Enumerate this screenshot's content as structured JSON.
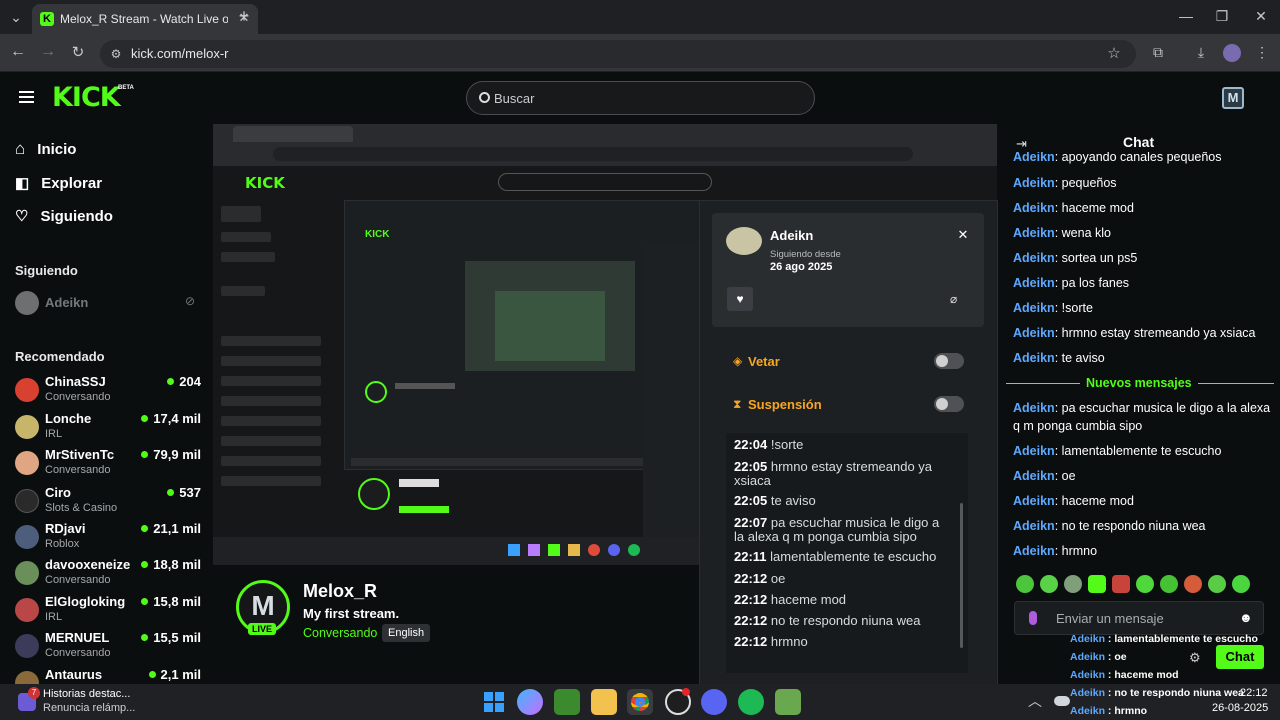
{
  "browser": {
    "tab_title": "Melox_R Stream - Watch Live o",
    "url": "kick.com/melox-r"
  },
  "header": {
    "logo": "KICK",
    "beta": "BETA",
    "search_placeholder": "Buscar"
  },
  "sidebar": {
    "nav": [
      {
        "label": "Inicio",
        "icon": "home-icon"
      },
      {
        "label": "Explorar",
        "icon": "compass-icon"
      },
      {
        "label": "Siguiendo",
        "icon": "heart-icon"
      }
    ],
    "following_title": "Siguiendo",
    "following": [
      {
        "name": "Adeikn"
      }
    ],
    "recommended_title": "Recomendado",
    "recommended": [
      {
        "name": "ChinaSSJ",
        "category": "Conversando",
        "viewers": "204",
        "color": "#d8402f"
      },
      {
        "name": "Lonche",
        "category": "IRL",
        "viewers": "17,4 mil",
        "color": "#c7b56a"
      },
      {
        "name": "MrStivenTc",
        "category": "Conversando",
        "viewers": "79,9 mil",
        "color": "#e0a582"
      },
      {
        "name": "Ciro",
        "category": "Slots & Casino",
        "viewers": "537",
        "color": "#2a2a2a"
      },
      {
        "name": "RDjavi",
        "category": "Roblox",
        "viewers": "21,1 mil",
        "color": "#4d5e7c"
      },
      {
        "name": "davooxeneize",
        "category": "Conversando",
        "viewers": "18,8 mil",
        "color": "#6b8f5a"
      },
      {
        "name": "ElGlogloking",
        "category": "IRL",
        "viewers": "15,8 mil",
        "color": "#b94747"
      },
      {
        "name": "MERNUEL",
        "category": "Conversando",
        "viewers": "15,5 mil",
        "color": "#3c3c5a"
      },
      {
        "name": "Antaurus",
        "category": "",
        "viewers": "2,1 mil",
        "color": "#8a6a3a"
      }
    ]
  },
  "stream": {
    "channel": "Melox_R",
    "title": "My first stream.",
    "category": "Conversando",
    "language": "English",
    "live_badge": "LIVE"
  },
  "popup": {
    "username": "Adeikn",
    "following_since_label": "Siguiendo desde",
    "following_since_date": "26 ago 2025",
    "veto_label": "Vetar",
    "suspend_label": "Suspensión",
    "history": [
      {
        "time": "22:04",
        "text": "!sorte"
      },
      {
        "time": "22:05",
        "text": "hrmno estay stremeando ya xsiaca"
      },
      {
        "time": "22:05",
        "text": "te aviso"
      },
      {
        "time": "22:07",
        "text": "pa escuchar musica le digo a la alexa q m ponga cumbia sipo"
      },
      {
        "time": "22:11",
        "text": "lamentablemente te escucho"
      },
      {
        "time": "22:12",
        "text": "oe"
      },
      {
        "time": "22:12",
        "text": "haceme mod"
      },
      {
        "time": "22:12",
        "text": "no te respondo niuna wea"
      },
      {
        "time": "22:12",
        "text": "hrmno"
      }
    ]
  },
  "chat": {
    "title": "Chat",
    "messages_before": [
      {
        "user": "Adeikn",
        "text": "apoyando canales pequeños"
      },
      {
        "user": "Adeikn",
        "text": "pequeños"
      },
      {
        "user": "Adeikn",
        "text": "haceme mod"
      },
      {
        "user": "Adeikn",
        "text": "wena klo"
      },
      {
        "user": "Adeikn",
        "text": "sortea un ps5"
      },
      {
        "user": "Adeikn",
        "text": "pa los fanes"
      },
      {
        "user": "Adeikn",
        "text": "!sorte"
      },
      {
        "user": "Adeikn",
        "text": "hrmno estay stremeando ya xsiaca"
      },
      {
        "user": "Adeikn",
        "text": "te aviso"
      }
    ],
    "new_messages_label": "Nuevos mensajes",
    "messages_after": [
      {
        "user": "Adeikn",
        "text": "pa escuchar musica le digo a la alexa q m ponga cumbia sipo"
      },
      {
        "user": "Adeikn",
        "text": "lamentablemente te escucho"
      },
      {
        "user": "Adeikn",
        "text": "oe"
      },
      {
        "user": "Adeikn",
        "text": "haceme mod"
      },
      {
        "user": "Adeikn",
        "text": "no te respondo niuna wea"
      },
      {
        "user": "Adeikn",
        "text": "hrmno"
      }
    ],
    "input_placeholder": "Enviar un mensaje",
    "send_label": "Chat"
  },
  "overlay": [
    {
      "user": "Adeikn",
      "text": "lamentablemente te escucho"
    },
    {
      "user": "Adeikn",
      "text": "oe"
    },
    {
      "user": "Adeikn",
      "text": "haceme mod"
    },
    {
      "user": "Adeikn",
      "text": "no te respondo niuna wea"
    },
    {
      "user": "Adeikn",
      "text": "hrmno"
    }
  ],
  "taskbar": {
    "news_title": "Historias destac...",
    "news_sub": "Renuncia relámp...",
    "news_badge": "7",
    "time": "22:12",
    "date": "26-08-2025"
  },
  "colors": {
    "accent": "#53fc18",
    "username": "#5ea8ff",
    "background": "#0b0e0f"
  }
}
